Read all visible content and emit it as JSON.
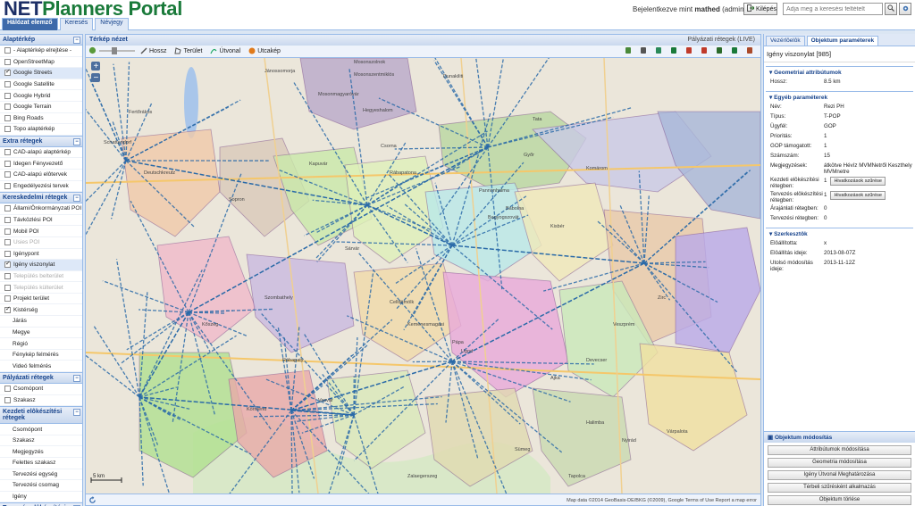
{
  "app": {
    "logo_net": "NET",
    "logo_rest": "Planners Portal",
    "tabs": [
      {
        "label": "Hálózat elemző",
        "active": true
      },
      {
        "label": "Keresés",
        "active": false
      },
      {
        "label": "Névjegy",
        "active": false
      }
    ]
  },
  "header": {
    "login_prefix": "Bejelentkezve mint",
    "login_user": "mathed",
    "login_role": "(admin)",
    "logout_label": "Kilépés",
    "search_placeholder": "Adja meg a keresési feltételt"
  },
  "sidebar": {
    "sections": [
      {
        "title": "Alaptérkép",
        "items": [
          {
            "label": "- Alaptérkép elrejtése -",
            "checked": false
          },
          {
            "label": "OpenStreetMap",
            "checked": false
          },
          {
            "label": "Google Streets",
            "checked": true,
            "highlight": true
          },
          {
            "label": "Google Satellite",
            "checked": false
          },
          {
            "label": "Google Hybrid",
            "checked": false
          },
          {
            "label": "Google Terrain",
            "checked": false
          },
          {
            "label": "Bing Roads",
            "checked": false
          },
          {
            "label": "Topo alaptérkép",
            "checked": false
          }
        ]
      },
      {
        "title": "Extra rétegek",
        "items": [
          {
            "label": "CAD-alapú alaptérkép",
            "checked": false
          },
          {
            "label": "Idegen Fényvezető",
            "checked": false
          },
          {
            "label": "CAD-alapú elôtervek",
            "checked": false
          },
          {
            "label": "Engedélyezési tervek",
            "checked": false
          }
        ]
      },
      {
        "title": "Kereskedelmi rétegek",
        "items": [
          {
            "label": "Állami/Önkormányzati POI",
            "checked": false
          },
          {
            "label": "Távközlési POI",
            "checked": false
          },
          {
            "label": "Mobil POI",
            "checked": false
          },
          {
            "label": "Usies POI",
            "checked": false,
            "disabled": true
          },
          {
            "label": "Igénypont",
            "checked": false
          },
          {
            "label": "Igény viszonylat",
            "checked": true,
            "highlight": true
          },
          {
            "label": "Település belterület",
            "checked": false,
            "disabled": true
          },
          {
            "label": "Település külterület",
            "checked": false,
            "disabled": true
          },
          {
            "label": "Projekt terület",
            "checked": false
          },
          {
            "label": "Kistérség",
            "checked": true
          },
          {
            "label": "Járás",
            "checked": false,
            "radio": true
          },
          {
            "label": "Megye",
            "checked": false,
            "radio": true
          },
          {
            "label": "Régió",
            "checked": false,
            "radio": true
          },
          {
            "label": "Fénykép felmérés",
            "checked": false,
            "radio": true
          },
          {
            "label": "Videó felmérés",
            "checked": false,
            "radio": true
          }
        ]
      },
      {
        "title": "Pályázati rétegek",
        "items": [
          {
            "label": "Csomópont",
            "checked": false
          },
          {
            "label": "Szakasz",
            "checked": false
          }
        ]
      },
      {
        "title": "Kezdeti elôkészítési rétegek",
        "items": [
          {
            "label": "Csomópont",
            "checked": false,
            "radio": true
          },
          {
            "label": "Szakasz",
            "checked": false,
            "radio": true
          },
          {
            "label": "Megjegyzés",
            "checked": false,
            "radio": true
          },
          {
            "label": "Felettes szakasz",
            "checked": false,
            "radio": true
          },
          {
            "label": "Tervezési egység",
            "checked": false,
            "radio": true
          },
          {
            "label": "Tervezési csomag",
            "checked": false,
            "radio": true
          },
          {
            "label": "Igény",
            "checked": false,
            "radio": true
          }
        ]
      },
      {
        "title": "Tervezés elôkészítési rétegek",
        "items": []
      }
    ]
  },
  "map": {
    "title": "Térkép nézet",
    "layer_name": "Pályázati rétegek (LIVE)",
    "tools": {
      "hossz": "Hossz",
      "terulet": "Terület",
      "utvonal": "Útvonal",
      "utcakep": "Utcakép"
    },
    "scale": "5 km",
    "attribution": "Map data ©2014 GeoBasis-DE/BKG (©2009), Google   Terms of Use   Report a map error",
    "zoom_in": "+",
    "zoom_out": "−",
    "places": [
      {
        "t": "Mosonszolnok"
      },
      {
        "t": "Jánossomorja"
      },
      {
        "t": "Mosonmagyaróvár"
      },
      {
        "t": "Dunakiliti"
      },
      {
        "t": "Hegyeshalom"
      },
      {
        "t": "Fertőrákos"
      },
      {
        "t": "Schattendorf"
      },
      {
        "t": "Deutschkreutz"
      },
      {
        "t": "Kapuvár"
      },
      {
        "t": "Csorna"
      },
      {
        "t": "Győr"
      },
      {
        "t": "Komárom"
      },
      {
        "t": "Pannonhalma"
      },
      {
        "t": "Pápa"
      },
      {
        "t": "Sopron"
      },
      {
        "t": "Kőszeg"
      },
      {
        "t": "Szombathely"
      },
      {
        "t": "Sárvár"
      },
      {
        "t": "Celldömölk"
      },
      {
        "t": "Körmend"
      },
      {
        "t": "Vasvár"
      },
      {
        "t": "Zalaegerszeg"
      },
      {
        "t": "Ajka"
      },
      {
        "t": "Devecser"
      },
      {
        "t": "Tata"
      },
      {
        "t": "Kisbér"
      },
      {
        "t": "Bábolna"
      },
      {
        "t": "Zirc"
      },
      {
        "t": "Veszprém"
      },
      {
        "t": "Várpalota"
      },
      {
        "t": "Sümeg"
      },
      {
        "t": "Tapolca"
      },
      {
        "t": "Rábapatona"
      },
      {
        "t": "Bagyogszovát"
      },
      {
        "t": "Kemenesmagasi"
      },
      {
        "t": "Ugod"
      },
      {
        "t": "Rábapaty"
      },
      {
        "t": "Halimba"
      },
      {
        "t": "Nyirád"
      },
      {
        "t": "Mosonszentmiklós"
      }
    ]
  },
  "object_panel": {
    "tabs": [
      {
        "label": "Vezérlôelôk",
        "active": false
      },
      {
        "label": "Objektum paraméterek",
        "active": true
      }
    ],
    "title": "Igény viszonylat [985]",
    "geom_header": "Geometriai attribútumok",
    "geom_rows": [
      {
        "k": "Hossz:",
        "v": "8.5 km"
      }
    ],
    "other_header": "Egyéb paraméterek",
    "other_rows": [
      {
        "k": "Név:",
        "v": "Rezi PH"
      },
      {
        "k": "Típus:",
        "v": "T-POP"
      },
      {
        "k": "Ügyfél:",
        "v": "GOP"
      },
      {
        "k": "Prioritás:",
        "v": "1"
      },
      {
        "k": "GOP támogatott:",
        "v": "1"
      },
      {
        "k": "Számszám:",
        "v": "15"
      },
      {
        "k": "Megjegyzések:",
        "v": "átkötve Hévíz MVMNetről Keszthely MVMnetre"
      }
    ],
    "rel_rows": [
      {
        "k": "Kezdeti elôkészítési rétegben:",
        "v": "1",
        "btn": "Hivatkozások szűrése"
      },
      {
        "k": "Tervezés elôkészítési rétegben:",
        "v": "1",
        "btn": "Hivatkozások szűrése"
      },
      {
        "k": "Árajánlati rétegben:",
        "v": "0"
      },
      {
        "k": "Tervezési rétegben:",
        "v": "0"
      }
    ],
    "editor_header": "Szerkesztôk",
    "editor_rows": [
      {
        "k": "Elôállította:",
        "v": "x"
      },
      {
        "k": "Elôállítás ideje:",
        "v": "2013-08-07Z"
      },
      {
        "k": "Utolsó módosítás ideje:",
        "v": "2013-11-12Z"
      }
    ]
  },
  "modification": {
    "header": "Objektum módosítás",
    "buttons": [
      "Attribútumok módosítása",
      "Geometria módosítása",
      "Igény Útvonal Meghatározása",
      "Térbeli szűrésként alkalmazás",
      "Objektum törlése"
    ]
  }
}
